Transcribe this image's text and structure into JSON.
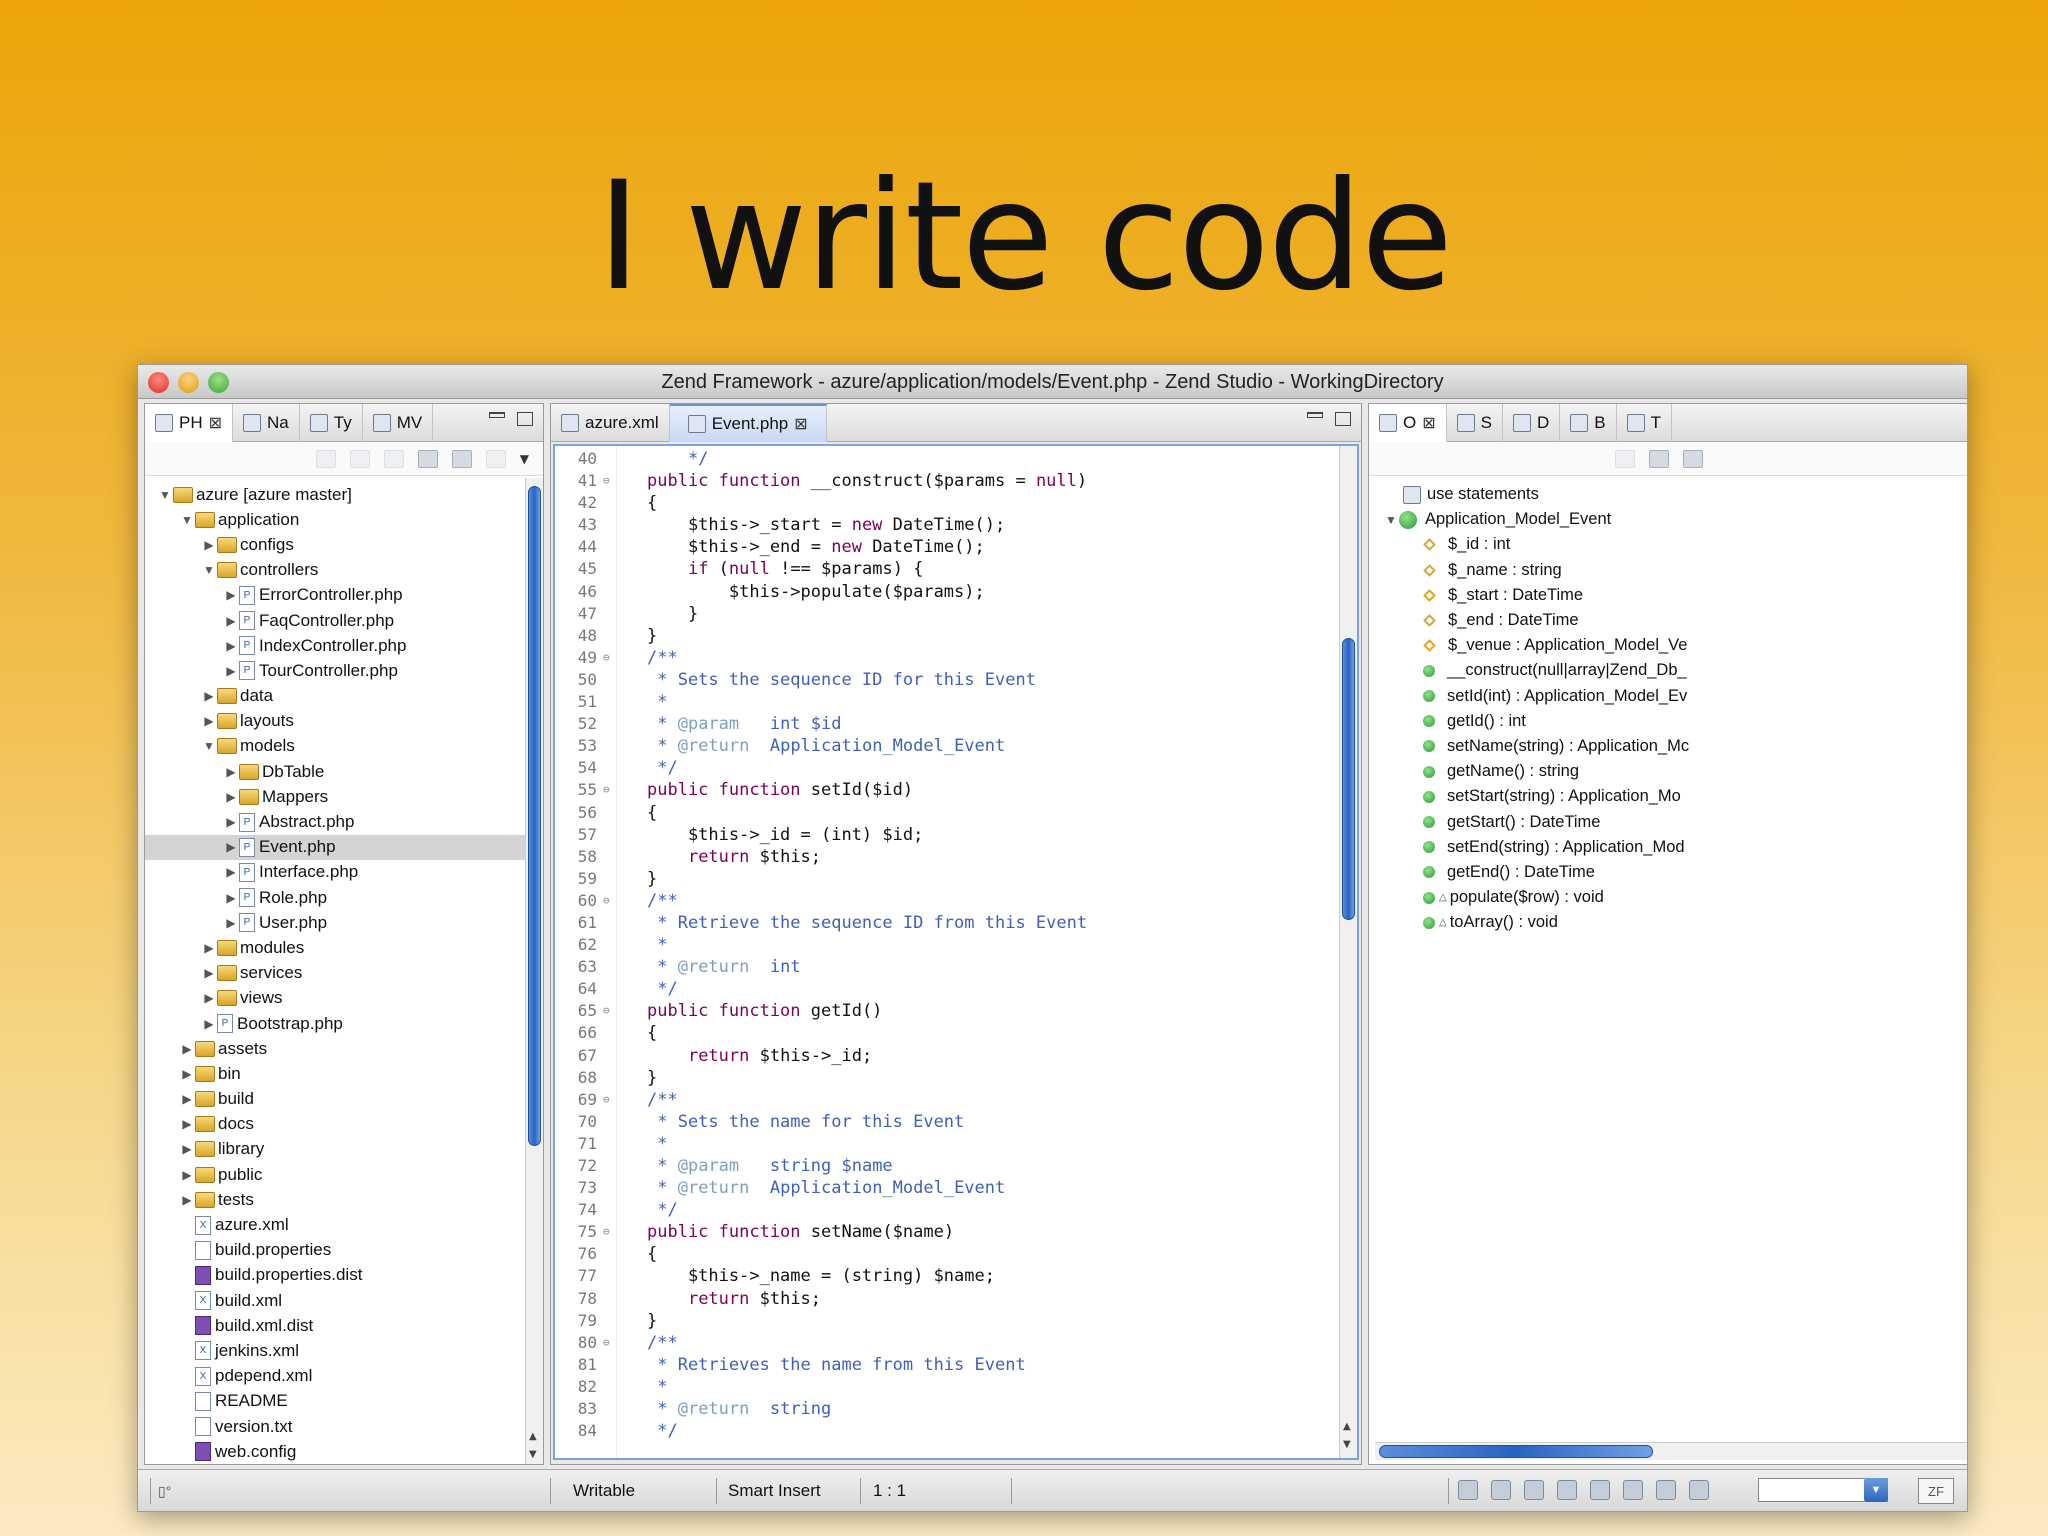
{
  "slide": {
    "title": "I write code"
  },
  "window": {
    "title": "Zend Framework - azure/application/models/Event.php - Zend Studio - WorkingDirectory"
  },
  "left_panel": {
    "tabs": [
      {
        "label": "PH",
        "icon": "php-explorer-icon",
        "closable": true
      },
      {
        "label": "Na",
        "icon": "navigator-icon"
      },
      {
        "label": "Ty",
        "icon": "type-hierarchy-icon"
      },
      {
        "label": "MV",
        "icon": "mvc-outline-icon"
      }
    ],
    "tree": [
      {
        "label": "azure [azure master]",
        "depth": 0,
        "type": "project",
        "expanded": true
      },
      {
        "label": "application",
        "depth": 1,
        "type": "folder",
        "expanded": true
      },
      {
        "label": "configs",
        "depth": 2,
        "type": "folder",
        "expanded": false
      },
      {
        "label": "controllers",
        "depth": 2,
        "type": "folder",
        "expanded": true
      },
      {
        "label": "ErrorController.php",
        "depth": 3,
        "type": "php",
        "expanded": false
      },
      {
        "label": "FaqController.php",
        "depth": 3,
        "type": "php",
        "expanded": false
      },
      {
        "label": "IndexController.php",
        "depth": 3,
        "type": "php",
        "expanded": false
      },
      {
        "label": "TourController.php",
        "depth": 3,
        "type": "php",
        "expanded": false
      },
      {
        "label": "data",
        "depth": 2,
        "type": "folder",
        "expanded": false
      },
      {
        "label": "layouts",
        "depth": 2,
        "type": "folder",
        "expanded": false
      },
      {
        "label": "models",
        "depth": 2,
        "type": "folder",
        "expanded": true
      },
      {
        "label": "DbTable",
        "depth": 3,
        "type": "folder",
        "expanded": false
      },
      {
        "label": "Mappers",
        "depth": 3,
        "type": "folder",
        "expanded": false
      },
      {
        "label": "Abstract.php",
        "depth": 3,
        "type": "php",
        "expanded": false
      },
      {
        "label": "Event.php",
        "depth": 3,
        "type": "php",
        "expanded": false,
        "selected": true
      },
      {
        "label": "Interface.php",
        "depth": 3,
        "type": "php",
        "expanded": false
      },
      {
        "label": "Role.php",
        "depth": 3,
        "type": "php",
        "expanded": false
      },
      {
        "label": "User.php",
        "depth": 3,
        "type": "php",
        "expanded": false
      },
      {
        "label": "modules",
        "depth": 2,
        "type": "folder",
        "expanded": false
      },
      {
        "label": "services",
        "depth": 2,
        "type": "folder",
        "expanded": false
      },
      {
        "label": "views",
        "depth": 2,
        "type": "folder",
        "expanded": false
      },
      {
        "label": "Bootstrap.php",
        "depth": 2,
        "type": "php",
        "expanded": false
      },
      {
        "label": "assets",
        "depth": 1,
        "type": "folder",
        "expanded": false
      },
      {
        "label": "bin",
        "depth": 1,
        "type": "folder",
        "expanded": false
      },
      {
        "label": "build",
        "depth": 1,
        "type": "folder",
        "expanded": false
      },
      {
        "label": "docs",
        "depth": 1,
        "type": "folder",
        "expanded": false
      },
      {
        "label": "library",
        "depth": 1,
        "type": "folder",
        "expanded": false
      },
      {
        "label": "public",
        "depth": 1,
        "type": "folder",
        "expanded": false
      },
      {
        "label": "tests",
        "depth": 1,
        "type": "folder",
        "expanded": false
      },
      {
        "label": "azure.xml",
        "depth": 1,
        "type": "xml"
      },
      {
        "label": "build.properties",
        "depth": 1,
        "type": "file"
      },
      {
        "label": "build.properties.dist",
        "depth": 1,
        "type": "purple"
      },
      {
        "label": "build.xml",
        "depth": 1,
        "type": "xml"
      },
      {
        "label": "build.xml.dist",
        "depth": 1,
        "type": "purple"
      },
      {
        "label": "jenkins.xml",
        "depth": 1,
        "type": "xml"
      },
      {
        "label": "pdepend.xml",
        "depth": 1,
        "type": "xml"
      },
      {
        "label": "README",
        "depth": 1,
        "type": "file"
      },
      {
        "label": "version.txt",
        "depth": 1,
        "type": "file"
      },
      {
        "label": "web.config",
        "depth": 1,
        "type": "purple"
      }
    ]
  },
  "editor": {
    "tabs": [
      {
        "label": "azure.xml",
        "active": false,
        "icon": "xml-file-icon"
      },
      {
        "label": "Event.php",
        "active": true,
        "icon": "php-file-icon",
        "closable": true
      }
    ],
    "lines": [
      {
        "n": "40",
        "fold": "",
        "t": [
          [
            "    */",
            "cm"
          ]
        ]
      },
      {
        "n": "41",
        "fold": "⊖",
        "t": [
          [
            "public function ",
            "kw"
          ],
          [
            "__construct($params = ",
            ""
          ],
          [
            "null",
            "kw"
          ],
          [
            ")",
            ""
          ]
        ]
      },
      {
        "n": "42",
        "fold": "",
        "t": [
          [
            "{",
            ""
          ]
        ]
      },
      {
        "n": "43",
        "fold": "",
        "t": [
          [
            "    $this->_start = ",
            ""
          ],
          [
            "new ",
            "kw"
          ],
          [
            "DateTime();",
            ""
          ]
        ]
      },
      {
        "n": "44",
        "fold": "",
        "t": [
          [
            "    $this->_end = ",
            ""
          ],
          [
            "new ",
            "kw"
          ],
          [
            "DateTime();",
            ""
          ]
        ]
      },
      {
        "n": "45",
        "fold": "",
        "t": [
          [
            "    ",
            ""
          ],
          [
            "if ",
            "kw"
          ],
          [
            "(",
            ""
          ],
          [
            "null ",
            "kw"
          ],
          [
            "!== $params) {",
            ""
          ]
        ]
      },
      {
        "n": "46",
        "fold": "",
        "t": [
          [
            "        $this->populate($params);",
            ""
          ]
        ]
      },
      {
        "n": "47",
        "fold": "",
        "t": [
          [
            "    }",
            ""
          ]
        ]
      },
      {
        "n": "48",
        "fold": "",
        "t": [
          [
            "}",
            ""
          ]
        ]
      },
      {
        "n": "49",
        "fold": "⊖",
        "t": [
          [
            "/**",
            "cm"
          ]
        ]
      },
      {
        "n": "50",
        "fold": "",
        "t": [
          [
            " * Sets the sequence ID for this Event",
            "cm"
          ]
        ]
      },
      {
        "n": "51",
        "fold": "",
        "t": [
          [
            " *",
            "cm"
          ]
        ]
      },
      {
        "n": "52",
        "fold": "",
        "t": [
          [
            " * ",
            "cm"
          ],
          [
            "@param",
            "tag"
          ],
          [
            "   int $id",
            "cm"
          ]
        ]
      },
      {
        "n": "53",
        "fold": "",
        "t": [
          [
            " * ",
            "cm"
          ],
          [
            "@return",
            "tag"
          ],
          [
            "  Application_Model_Event",
            "cm"
          ]
        ]
      },
      {
        "n": "54",
        "fold": "",
        "t": [
          [
            " */",
            "cm"
          ]
        ]
      },
      {
        "n": "55",
        "fold": "⊖",
        "t": [
          [
            "public function ",
            "kw"
          ],
          [
            "setId($id)",
            ""
          ]
        ]
      },
      {
        "n": "56",
        "fold": "",
        "t": [
          [
            "{",
            ""
          ]
        ]
      },
      {
        "n": "57",
        "fold": "",
        "t": [
          [
            "    $this->_id = (int) $id;",
            ""
          ]
        ]
      },
      {
        "n": "58",
        "fold": "",
        "t": [
          [
            "    ",
            ""
          ],
          [
            "return ",
            "kw"
          ],
          [
            "$this;",
            ""
          ]
        ]
      },
      {
        "n": "59",
        "fold": "",
        "t": [
          [
            "}",
            ""
          ]
        ]
      },
      {
        "n": "60",
        "fold": "⊖",
        "t": [
          [
            "/**",
            "cm"
          ]
        ]
      },
      {
        "n": "61",
        "fold": "",
        "t": [
          [
            " * Retrieve the sequence ID from this Event",
            "cm"
          ]
        ]
      },
      {
        "n": "62",
        "fold": "",
        "t": [
          [
            " *",
            "cm"
          ]
        ]
      },
      {
        "n": "63",
        "fold": "",
        "t": [
          [
            " * ",
            "cm"
          ],
          [
            "@return",
            "tag"
          ],
          [
            "  int",
            "cm"
          ]
        ]
      },
      {
        "n": "64",
        "fold": "",
        "t": [
          [
            " */",
            "cm"
          ]
        ]
      },
      {
        "n": "65",
        "fold": "⊖",
        "t": [
          [
            "public function ",
            "kw"
          ],
          [
            "getId()",
            ""
          ]
        ]
      },
      {
        "n": "66",
        "fold": "",
        "t": [
          [
            "{",
            ""
          ]
        ]
      },
      {
        "n": "67",
        "fold": "",
        "t": [
          [
            "    ",
            ""
          ],
          [
            "return ",
            "kw"
          ],
          [
            "$this->_id;",
            ""
          ]
        ]
      },
      {
        "n": "68",
        "fold": "",
        "t": [
          [
            "}",
            ""
          ]
        ]
      },
      {
        "n": "69",
        "fold": "⊖",
        "t": [
          [
            "/**",
            "cm"
          ]
        ]
      },
      {
        "n": "70",
        "fold": "",
        "t": [
          [
            " * Sets the name for this Event",
            "cm"
          ]
        ]
      },
      {
        "n": "71",
        "fold": "",
        "t": [
          [
            " *",
            "cm"
          ]
        ]
      },
      {
        "n": "72",
        "fold": "",
        "t": [
          [
            " * ",
            "cm"
          ],
          [
            "@param",
            "tag"
          ],
          [
            "   string $name",
            "cm"
          ]
        ]
      },
      {
        "n": "73",
        "fold": "",
        "t": [
          [
            " * ",
            "cm"
          ],
          [
            "@return",
            "tag"
          ],
          [
            "  Application_Model_Event",
            "cm"
          ]
        ]
      },
      {
        "n": "74",
        "fold": "",
        "t": [
          [
            " */",
            "cm"
          ]
        ]
      },
      {
        "n": "75",
        "fold": "⊖",
        "t": [
          [
            "public function ",
            "kw"
          ],
          [
            "setName($name)",
            ""
          ]
        ]
      },
      {
        "n": "76",
        "fold": "",
        "t": [
          [
            "{",
            ""
          ]
        ]
      },
      {
        "n": "77",
        "fold": "",
        "t": [
          [
            "    $this->_name = (string) $name;",
            ""
          ]
        ]
      },
      {
        "n": "78",
        "fold": "",
        "t": [
          [
            "    ",
            ""
          ],
          [
            "return ",
            "kw"
          ],
          [
            "$this;",
            ""
          ]
        ]
      },
      {
        "n": "79",
        "fold": "",
        "t": [
          [
            "}",
            ""
          ]
        ]
      },
      {
        "n": "80",
        "fold": "⊖",
        "t": [
          [
            "/**",
            "cm"
          ]
        ]
      },
      {
        "n": "81",
        "fold": "",
        "t": [
          [
            " * Retrieves the name from this Event",
            "cm"
          ]
        ]
      },
      {
        "n": "82",
        "fold": "",
        "t": [
          [
            " *",
            "cm"
          ]
        ]
      },
      {
        "n": "83",
        "fold": "",
        "t": [
          [
            " * ",
            "cm"
          ],
          [
            "@return",
            "tag"
          ],
          [
            "  string",
            "cm"
          ]
        ]
      },
      {
        "n": "84",
        "fold": "",
        "t": [
          [
            " */",
            "cm"
          ]
        ]
      }
    ]
  },
  "outline": {
    "tabs": [
      {
        "label": "O",
        "icon": "outline-icon",
        "closable": true
      },
      {
        "label": "S",
        "icon": "snippets-icon"
      },
      {
        "label": "D",
        "icon": "debug-icon"
      },
      {
        "label": "B",
        "icon": "breakpoints-icon"
      },
      {
        "label": "T",
        "icon": "tasks-icon"
      }
    ],
    "items": [
      {
        "label": "use statements",
        "kind": "use",
        "depth": 0
      },
      {
        "label": "Application_Model_Event",
        "kind": "class",
        "depth": 0
      },
      {
        "label": "$_id : int",
        "kind": "field",
        "depth": 1
      },
      {
        "label": "$_name : string",
        "kind": "field",
        "depth": 1
      },
      {
        "label": "$_start : DateTime",
        "kind": "field",
        "depth": 1
      },
      {
        "label": "$_end : DateTime",
        "kind": "field",
        "depth": 1
      },
      {
        "label": "$_venue : Application_Model_Ve",
        "kind": "field",
        "depth": 1
      },
      {
        "label": "__construct(null|array|Zend_Db_",
        "kind": "ctor",
        "depth": 1
      },
      {
        "label": "setId(int) : Application_Model_Ev",
        "kind": "method",
        "depth": 1
      },
      {
        "label": "getId() : int",
        "kind": "method",
        "depth": 1
      },
      {
        "label": "setName(string) : Application_Mc",
        "kind": "method",
        "depth": 1
      },
      {
        "label": "getName() : string",
        "kind": "method",
        "depth": 1
      },
      {
        "label": "setStart(string) : Application_Mo",
        "kind": "method",
        "depth": 1
      },
      {
        "label": "getStart() : DateTime",
        "kind": "method",
        "depth": 1
      },
      {
        "label": "setEnd(string) : Application_Mod",
        "kind": "method",
        "depth": 1
      },
      {
        "label": "getEnd() : DateTime",
        "kind": "method",
        "depth": 1
      },
      {
        "label": "populate($row) : void",
        "kind": "method-a",
        "depth": 1
      },
      {
        "label": "toArray() : void",
        "kind": "method-a",
        "depth": 1
      }
    ]
  },
  "status": {
    "writable": "Writable",
    "insert_mode": "Smart Insert",
    "position": "1 : 1"
  },
  "colors": {
    "accent": "#2A62C2",
    "keyword": "#7F0055",
    "comment": "#3F5FBF",
    "javadoc_tag": "#7F9FBF"
  }
}
